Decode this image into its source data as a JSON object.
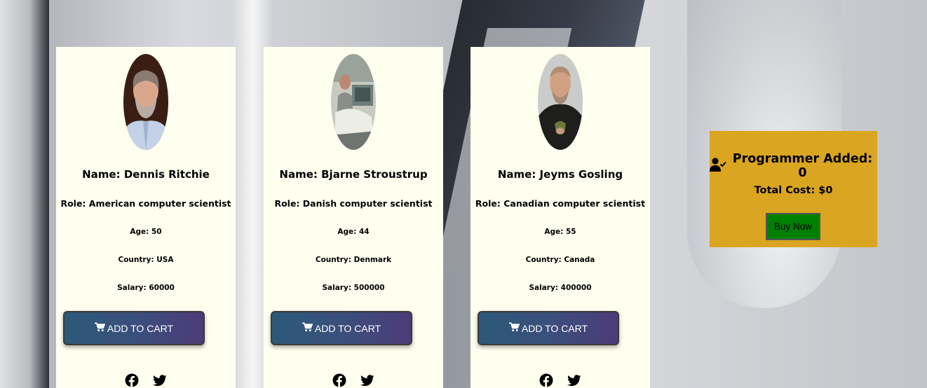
{
  "programmers": [
    {
      "name": "Name: Dennis Ritchie",
      "role": "Role: American computer scientist",
      "age": "Age: 50",
      "country": "Country: USA",
      "salary": "Salary: 60000",
      "add_label": "ADD TO CART"
    },
    {
      "name": "Name: Bjarne Stroustrup",
      "role": "Role: Danish computer scientist",
      "age": "Age: 44",
      "country": "Country: Denmark",
      "salary": "Salary: 500000",
      "add_label": "ADD TO CART"
    },
    {
      "name": "Name: Jeyms Gosling",
      "role": "Role: Canadian computer scientist",
      "age": "Age: 55",
      "country": "Country: Canada",
      "salary": "Salary: 400000",
      "add_label": "ADD TO CART"
    }
  ],
  "summary": {
    "title": "Programmer Added: 0",
    "cost": "Total Cost: $0",
    "buy_label": "Buy Now"
  },
  "icons": {
    "cart": "cart-icon",
    "facebook": "facebook-icon",
    "twitter": "twitter-icon",
    "user_check": "user-check-icon"
  },
  "colors": {
    "card_bg": "#fffff0",
    "summary_bg": "#daa520",
    "buy_button": "#008000",
    "add_button_start": "#2c5978",
    "add_button_end": "#4b3c78"
  }
}
